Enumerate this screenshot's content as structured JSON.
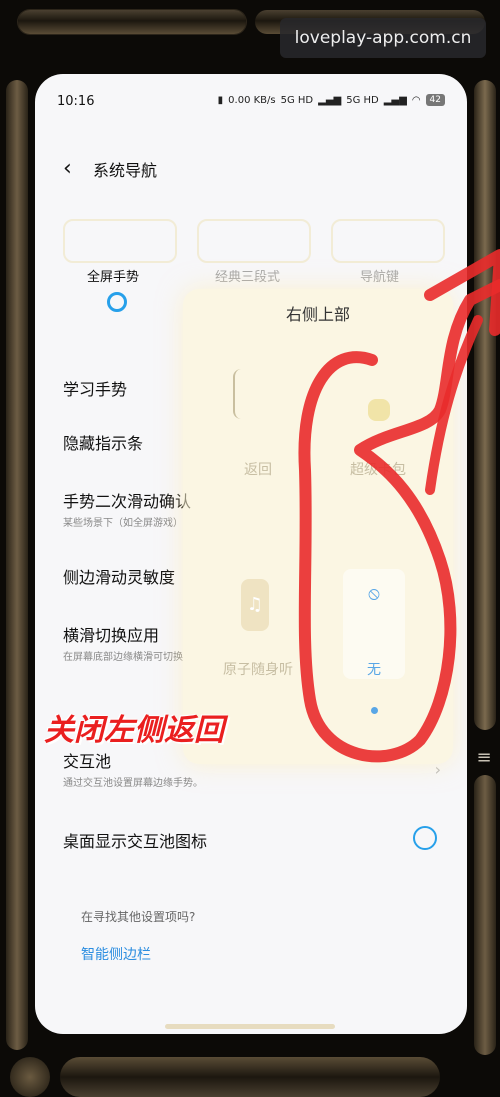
{
  "watermark": "loveplay-app.com.cn",
  "status": {
    "time": "10:16",
    "speed": "0.00 KB/s",
    "network1": "5G HD",
    "network2": "5G HD",
    "battery": "42"
  },
  "header": {
    "title": "系统导航"
  },
  "nav_modes": {
    "gesture": "全屏手势",
    "classic": "经典三段式",
    "button": "导航键"
  },
  "settings": [
    {
      "label": "学习手势"
    },
    {
      "label": "隐藏指示条"
    },
    {
      "label": "手势二次滑动确认",
      "sub": "某些场景下（如全屏游戏）"
    },
    {
      "label": "侧边滑动灵敏度"
    },
    {
      "label": "横滑切换应用",
      "sub": "在屏幕底部边缘横滑可切换"
    },
    {
      "label": "交互池",
      "sub": "通过交互池设置屏幕边缘手势。"
    },
    {
      "label": "桌面显示交互池图标"
    }
  ],
  "footer": {
    "hint": "在寻找其他设置项吗?",
    "link": "智能侧边栏"
  },
  "overlay": {
    "title": "右侧上部",
    "opt_back": "返回",
    "opt_wallet": "超级卡包",
    "opt_music": "原子随身听",
    "opt_none": "无"
  },
  "annotation": "关闭左侧返回",
  "colors": {
    "accent": "#27a0ea",
    "annotation": "#ea1f1f"
  }
}
